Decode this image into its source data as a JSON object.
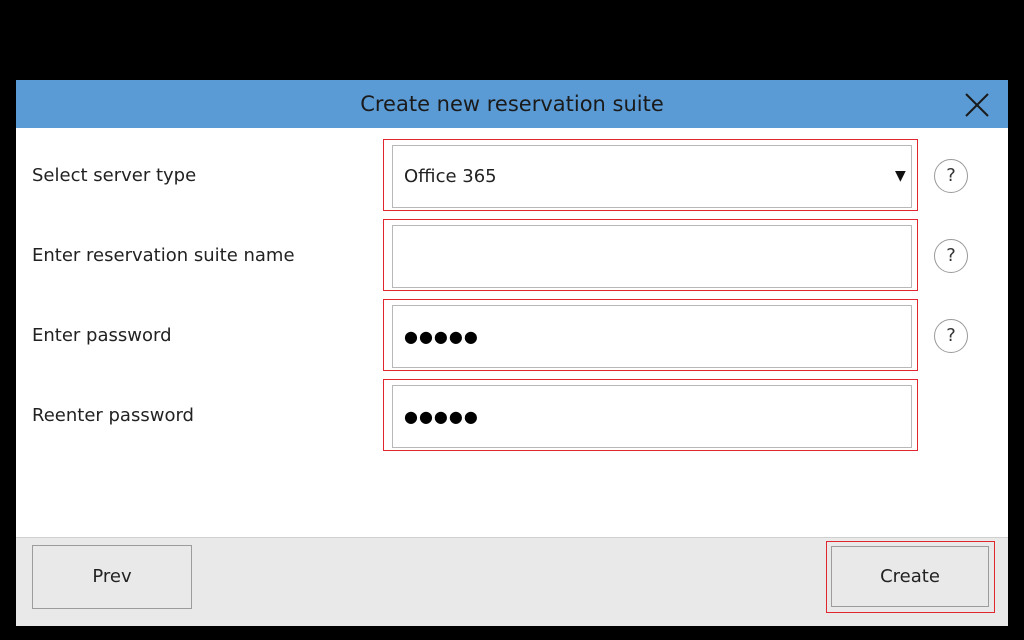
{
  "dialog": {
    "title": "Create new reservation suite",
    "close_icon": "close-x-icon"
  },
  "form": {
    "server_type": {
      "label": "Select server type",
      "value": "Office 365",
      "arrow": "▼"
    },
    "suite_name": {
      "label": "Enter reservation suite name",
      "value": ""
    },
    "password": {
      "label": "Enter password",
      "value": "●●●●●"
    },
    "reenter_password": {
      "label": "Reenter password",
      "value": "●●●●●"
    },
    "help_label": "?"
  },
  "footer": {
    "prev_label": "Prev",
    "create_label": "Create"
  },
  "colors": {
    "titlebar": "#5b9bd5",
    "highlight_border": "#e0262e",
    "footer_bg": "#e9e9e9"
  }
}
